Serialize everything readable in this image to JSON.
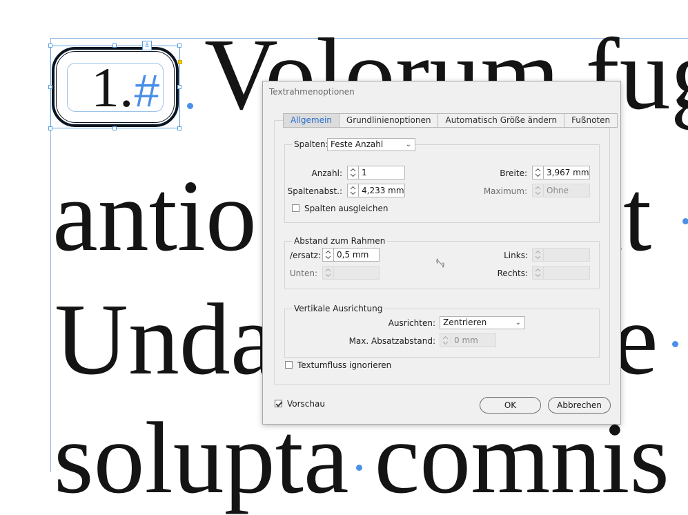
{
  "document": {
    "line1": "Volorum fug",
    "line2_left": "antio",
    "line2_right": "it",
    "line3_left": "Unda",
    "line3_right": "e",
    "line4": "solupta comnis",
    "anchor_number": "1.",
    "anchor_marker": "#"
  },
  "dialog": {
    "title": "Textrahmenoptionen",
    "tabs": [
      {
        "label": "Allgemein",
        "active": true
      },
      {
        "label": "Grundlinienoptionen",
        "active": false
      },
      {
        "label": "Automatisch Größe ändern",
        "active": false
      },
      {
        "label": "Fußnoten",
        "active": false
      }
    ],
    "columns": {
      "label": "Spalten:",
      "mode": "Feste Anzahl",
      "count_label": "Anzahl:",
      "count_value": "1",
      "gutter_label": "Spaltenabst.:",
      "gutter_value": "4,233 mm",
      "width_label": "Breite:",
      "width_value": "3,967 mm",
      "max_label": "Maximum:",
      "max_value": "Ohne",
      "balance_label": "Spalten ausgleichen",
      "balance_checked": false
    },
    "inset": {
      "group_label": "Abstand zum Rahmen",
      "top_label": "/ersatz:",
      "top_value": "0,5 mm",
      "bottom_label": "Unten:",
      "left_label": "Links:",
      "right_label": "Rechts:",
      "link_icon": "broken-chain-icon"
    },
    "vertical": {
      "group_label": "Vertikale Ausrichtung",
      "align_label": "Ausrichten:",
      "align_value": "Zentrieren",
      "max_spacing_label": "Max. Absatzabstand:",
      "max_spacing_value": "0 mm"
    },
    "ignore_wrap_label": "Textumfluss ignorieren",
    "ignore_wrap_checked": false,
    "preview_label": "Vorschau",
    "preview_checked": true,
    "ok_label": "OK",
    "cancel_label": "Abbrechen"
  },
  "colors": {
    "accent": "#2a6fcf",
    "frame_blue": "#4a90e8",
    "handle_yellow": "#f5d000"
  }
}
